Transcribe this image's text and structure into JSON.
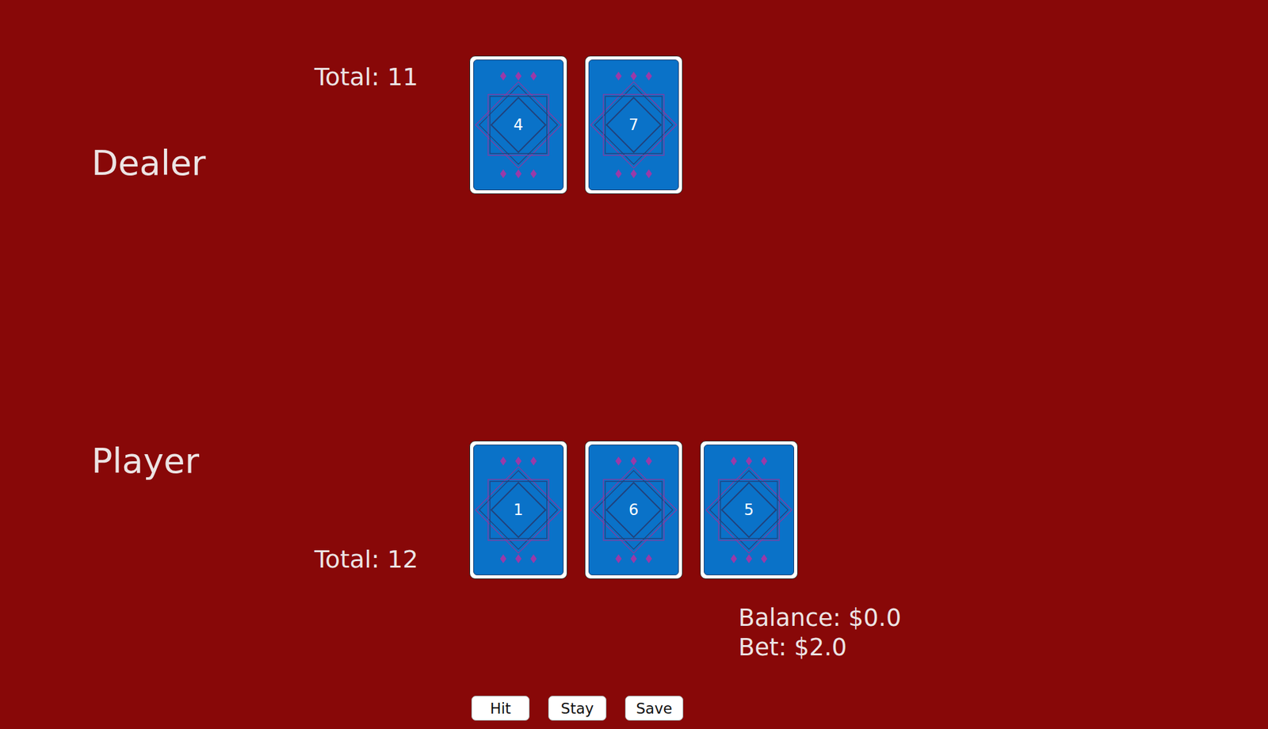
{
  "dealer": {
    "label": "Dealer",
    "total": "Total: 11",
    "cards": [
      {
        "value": "4"
      },
      {
        "value": "7"
      }
    ]
  },
  "player": {
    "label": "Player",
    "total": "Total: 12",
    "cards": [
      {
        "value": "1"
      },
      {
        "value": "6"
      },
      {
        "value": "5"
      }
    ]
  },
  "balance": "Balance: $0.0",
  "bet": "Bet: $2.0",
  "buttons": [
    "Hit",
    "Stay",
    "Save"
  ]
}
